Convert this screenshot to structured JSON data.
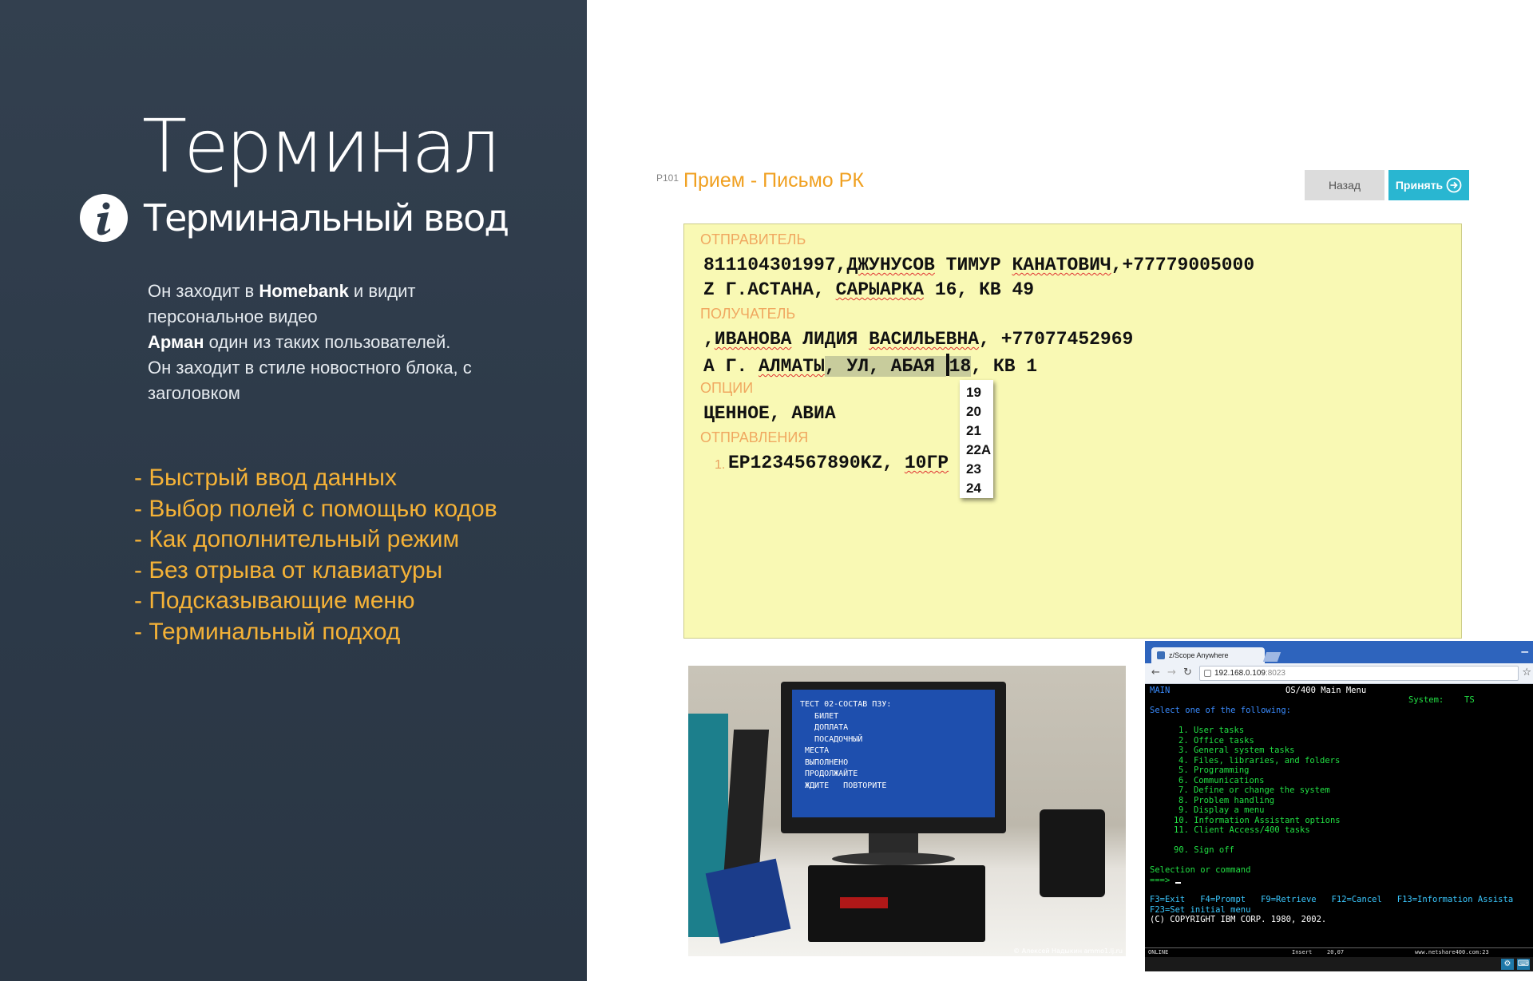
{
  "slide": {
    "title": "Терминал",
    "subtitle": "Терминальный ввод",
    "info_icon": "info-icon",
    "intro": {
      "line1_pre": "Он заходит в ",
      "line1_bold": "Homebank",
      "line1_post": " и видит",
      "line2": "персональное видео",
      "line3_bold": "Арман",
      "line3_post": " один из таких пользователей.",
      "line4": "Он заходит в стиле новостного блока, с",
      "line5": "заголовком"
    },
    "features": [
      "- Быстрый ввод данных",
      "- Выбор полей с помощью кодов",
      "- Как дополнительный режим",
      "- Без отрыва от клавиатуры",
      "- Подсказывающие меню",
      "- Терминальный подход"
    ]
  },
  "form": {
    "code": "P101",
    "title": "Прием - Письмо РК",
    "back_label": "Назад",
    "accept_label": "Принять",
    "accept_icon": "arrow-right-circle-icon",
    "sender_label": "ОТПРАВИТЕЛЬ",
    "sender_line1_pre": "811104301997,",
    "sender_line1_name": "ДЖУНУСОВ",
    "sender_line1_sp": " ТИМУР ",
    "sender_line1_patr": "КАНАТОВИЧ",
    "sender_line1_post": ",+77779005000",
    "sender_line2_pre": "Z Г.АСТАНА, ",
    "sender_line2_street": "САРЫАРКА",
    "sender_line2_post": " 16, КВ 49",
    "recipient_label": "ПОЛУЧАТЕЛЬ",
    "recipient_line1_pre": ",",
    "recipient_line1_name": "ИВАНОВА",
    "recipient_line1_mid": " ЛИДИЯ ",
    "recipient_line1_patr": "ВАСИЛЬЕВНА",
    "recipient_line1_post": ", +77077452969",
    "recipient_line2_pre": "А Г. ",
    "recipient_line2_city": "АЛМАТЫ",
    "recipient_line2_hl": ", УЛ, АБАЯ ",
    "recipient_line2_num": "18",
    "recipient_line2_post": ", КВ 1",
    "options_label": "ОПЦИИ",
    "options_value": "ЦЕННОЕ, АВИА",
    "items_label": "ОТПРАВЛЕНИЯ",
    "item_number": "1.",
    "item_code": "ЕР1234567890KZ, ",
    "item_rest": "10ГР",
    "suggestions": [
      "19",
      "20",
      "21",
      "22А",
      "23",
      "24"
    ]
  },
  "photo": {
    "screen_lines": [
      "ТЕСТ 02-СОСТАВ ПЗУ:",
      "   БИЛЕТ",
      "   ДОПЛАТА",
      "   ПОСАДОЧНЫЙ",
      " МЕСТА",
      " ВЫПОЛНЕНО",
      " ПРОДОЛЖАЙТЕ",
      " ЖДИТЕ   ПОВТОРИТЕ"
    ],
    "credit": "© Алексей Надыкин ammo1.lj.ru"
  },
  "browser": {
    "tab_title": "z/Scope Anywhere",
    "address_host": "192.168.0.109",
    "address_port": ":8023",
    "terminal": {
      "header_left": "MAIN",
      "header_center": "OS/400 Main Menu",
      "system_label": "System:",
      "system_value": "TS",
      "prompt": "Select one of the following:",
      "menu_items": [
        "1. User tasks",
        "2. Office tasks",
        "3. General system tasks",
        "4. Files, libraries, and folders",
        "5. Programming",
        "6. Communications",
        "7. Define or change the system",
        "8. Problem handling",
        "9. Display a menu",
        "10. Information Assistant options",
        "11. Client Access/400 tasks"
      ],
      "sign_off": "90. Sign off",
      "selection_label": "Selection or command",
      "input_prompt": "===>",
      "fkeys_line1": "F3=Exit   F4=Prompt   F9=Retrieve   F12=Cancel   F13=Information Assista",
      "fkeys_line2": "F23=Set initial menu",
      "copyright": "(C) COPYRIGHT IBM CORP. 1980, 2002."
    },
    "status": {
      "online": "ONLINE",
      "mode": "Insert",
      "position": "20,07",
      "site": "www.netshare400.com:23"
    }
  }
}
